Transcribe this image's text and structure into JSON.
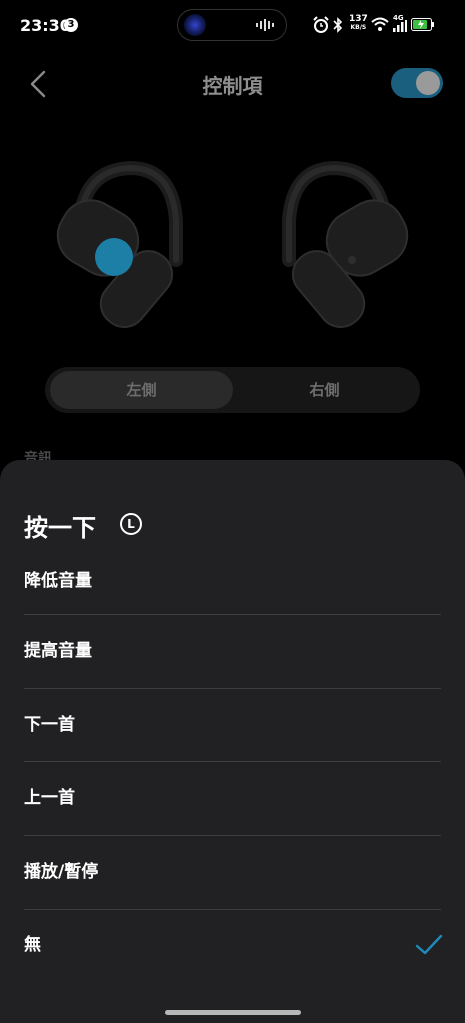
{
  "status_bar": {
    "time": "23:30",
    "notification_count": "3",
    "net_speed_value": "137",
    "net_speed_unit": "KB/S",
    "network_type": "4G",
    "icons": [
      "alarm-icon",
      "bluetooth-icon",
      "wifi-icon",
      "signal-icon",
      "battery-charging-icon"
    ]
  },
  "header": {
    "title": "控制項",
    "toggle_on": true
  },
  "side_selector": {
    "tabs": [
      {
        "label": "左側",
        "selected": true
      },
      {
        "label": "右側",
        "selected": false
      }
    ]
  },
  "section": {
    "label": "音訊"
  },
  "sheet": {
    "title": "按一下",
    "badge": "L",
    "options": [
      {
        "label": "降低音量",
        "selected": false
      },
      {
        "label": "提高音量",
        "selected": false
      },
      {
        "label": "下一首",
        "selected": false
      },
      {
        "label": "上一首",
        "selected": false
      },
      {
        "label": "播放/暫停",
        "selected": false
      },
      {
        "label": "無",
        "selected": true
      }
    ]
  },
  "colors": {
    "accent": "#1f8bb8",
    "toggle_track": "#1a5f7e",
    "sheet_bg": "#212123",
    "highlight_dot": "#1d7fa6"
  }
}
